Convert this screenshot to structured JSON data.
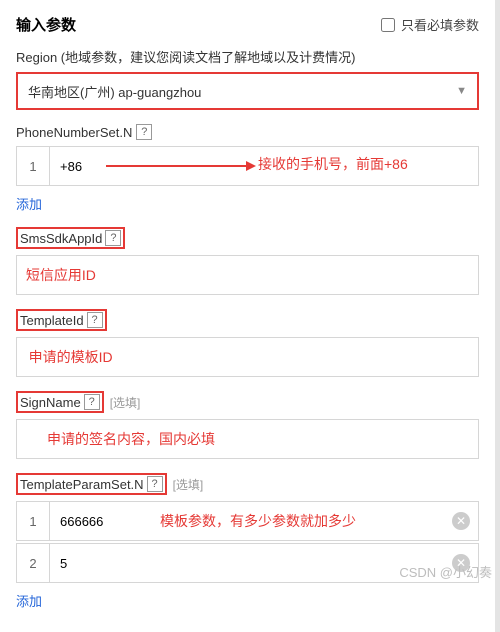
{
  "header": {
    "title": "输入参数",
    "required_only_label": "只看必填参数"
  },
  "region": {
    "label": "Region (地域参数，建议您阅读文档了解地域以及计费情况)",
    "value": "华南地区(广州) ap-guangzhou"
  },
  "phone": {
    "label": "PhoneNumberSet.N",
    "rows": [
      {
        "index": "1",
        "value": "+86"
      }
    ],
    "add_label": "添加",
    "annotation": "接收的手机号，前面+86"
  },
  "appid": {
    "label": "SmsSdkAppId",
    "value": "",
    "annotation": "短信应用ID"
  },
  "template": {
    "label": "TemplateId",
    "value": "",
    "annotation": "申请的模板ID"
  },
  "sign": {
    "label": "SignName",
    "optional": "[选填]",
    "value": "",
    "annotation": "申请的签名内容，国内必填"
  },
  "params": {
    "label": "TemplateParamSet.N",
    "optional": "[选填]",
    "rows": [
      {
        "index": "1",
        "value": "666666"
      },
      {
        "index": "2",
        "value": "5"
      }
    ],
    "add_label": "添加",
    "annotation": "模板参数，有多少参数就加多少"
  },
  "icons": {
    "help": "?",
    "clear": "✕",
    "dropdown": "▼"
  },
  "watermark": "CSDN @小幻奏"
}
